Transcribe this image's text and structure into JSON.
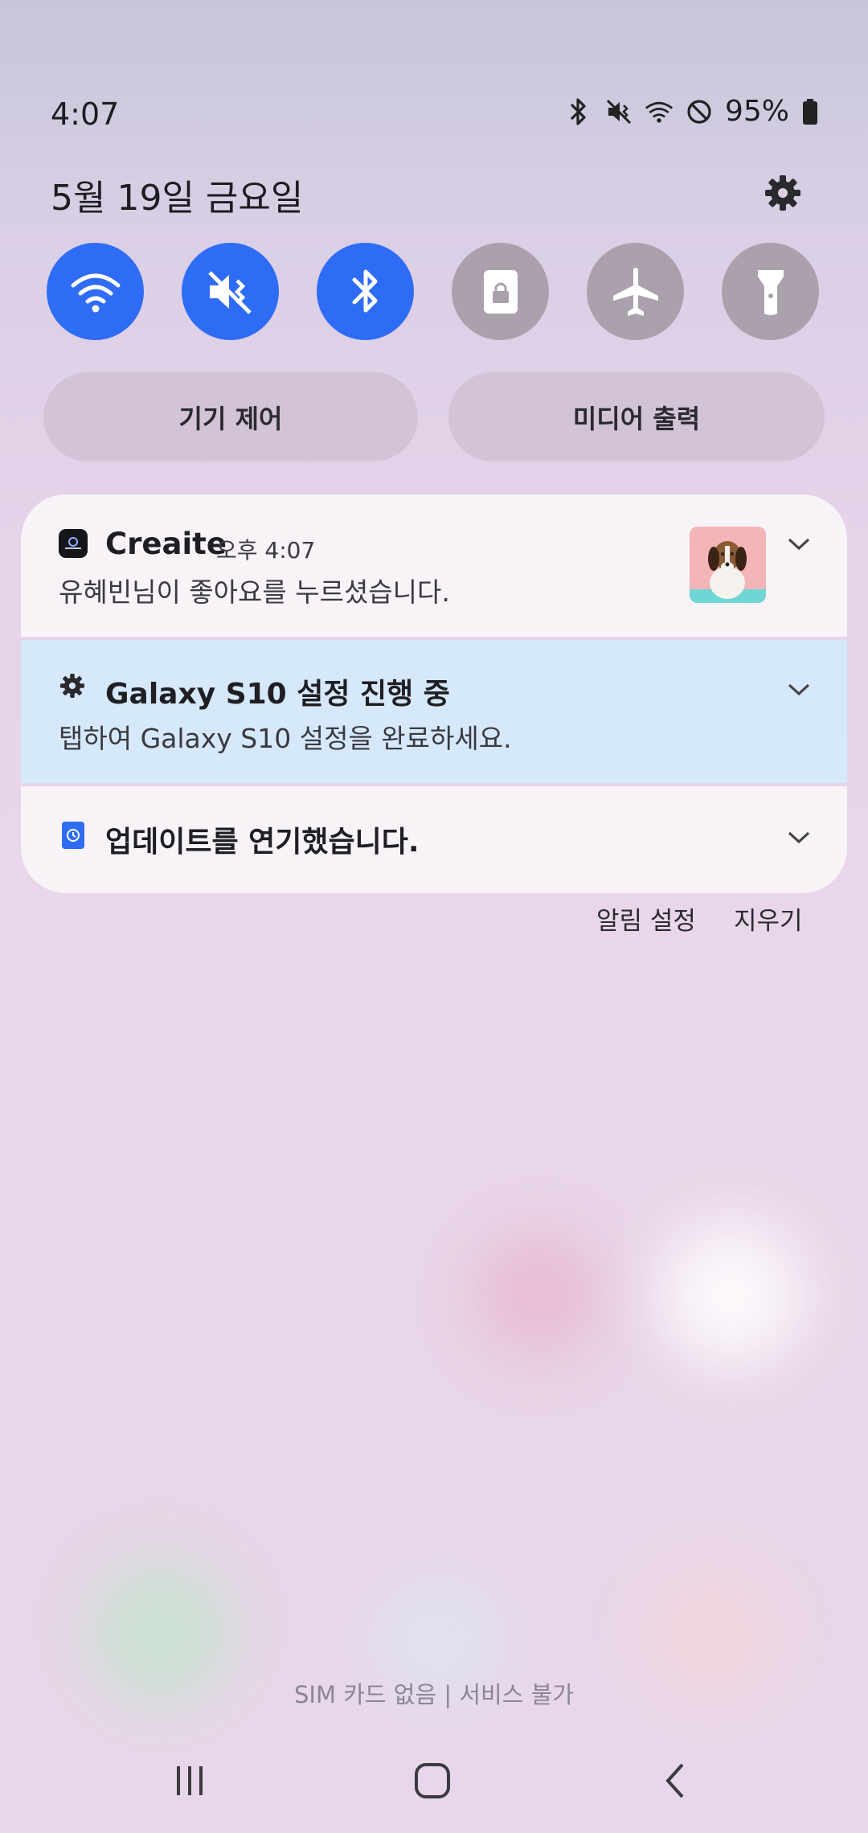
{
  "status_bar": {
    "time": "4:07",
    "battery_percent": "95%",
    "icons": [
      "bluetooth-icon",
      "mute-icon",
      "wifi-icon",
      "do-not-disturb-icon",
      "battery-icon"
    ]
  },
  "header": {
    "date": "5월 19일 금요일"
  },
  "quick_settings": [
    {
      "name": "wifi-icon",
      "active": true
    },
    {
      "name": "sound-mute-icon",
      "active": true
    },
    {
      "name": "bluetooth-icon",
      "active": true
    },
    {
      "name": "screen-lock-icon",
      "active": false
    },
    {
      "name": "airplane-icon",
      "active": false
    },
    {
      "name": "flashlight-icon",
      "active": false
    }
  ],
  "pills": {
    "device_control": "기기 제어",
    "media_output": "미디어 출력"
  },
  "notifications": [
    {
      "app": "Creaite",
      "time": "오후 4:07",
      "text": "유혜빈님이 좋아요를 누르셨습니다."
    },
    {
      "title": "Galaxy S10 설정 진행 중",
      "text": "탭하여 Galaxy S10 설정을 완료하세요."
    },
    {
      "title": "업데이트를 연기했습니다."
    }
  ],
  "actions": {
    "notification_settings": "알림 설정",
    "clear": "지우기"
  },
  "footer": {
    "sim_status": "SIM 카드 없음 | 서비스 불가"
  },
  "colors": {
    "accent": "#2f6cf5",
    "tile_off": "#aaa1ad",
    "setup_card": "#d6e8fb"
  }
}
